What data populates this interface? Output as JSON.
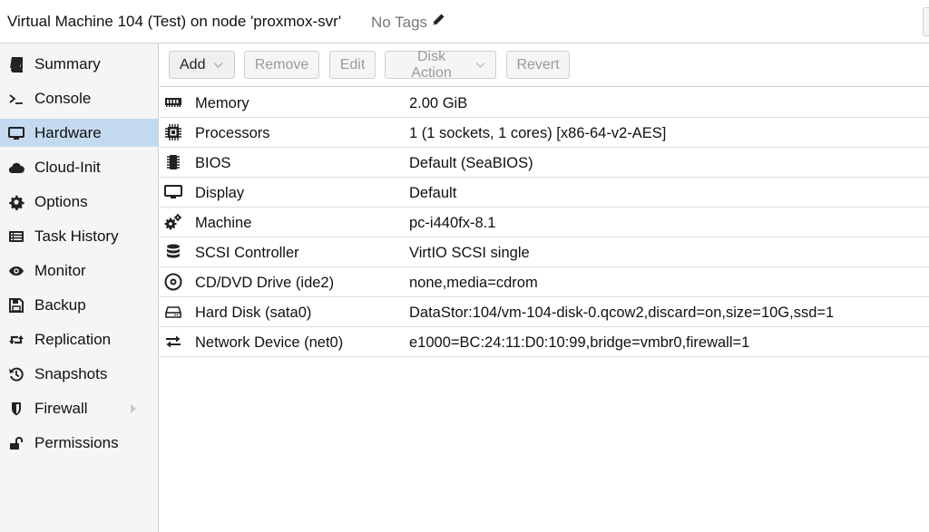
{
  "header": {
    "title": "Virtual Machine 104 (Test) on node 'proxmox-svr'",
    "tags_label": "No Tags"
  },
  "sidebar": {
    "items": [
      {
        "label": "Summary",
        "icon": "book-icon"
      },
      {
        "label": "Console",
        "icon": "terminal-icon"
      },
      {
        "label": "Hardware",
        "icon": "desktop-icon",
        "active": true
      },
      {
        "label": "Cloud-Init",
        "icon": "cloud-icon"
      },
      {
        "label": "Options",
        "icon": "gear-icon"
      },
      {
        "label": "Task History",
        "icon": "list-icon"
      },
      {
        "label": "Monitor",
        "icon": "eye-icon"
      },
      {
        "label": "Backup",
        "icon": "floppy-icon"
      },
      {
        "label": "Replication",
        "icon": "retweet-icon"
      },
      {
        "label": "Snapshots",
        "icon": "history-icon"
      },
      {
        "label": "Firewall",
        "icon": "shield-icon",
        "expandable": true
      },
      {
        "label": "Permissions",
        "icon": "unlock-icon"
      }
    ]
  },
  "toolbar": {
    "add_label": "Add",
    "remove_label": "Remove",
    "edit_label": "Edit",
    "disk_action_label": "Disk Action",
    "revert_label": "Revert"
  },
  "hardware": {
    "rows": [
      {
        "name": "Memory",
        "value": "2.00 GiB",
        "icon": "memory-icon"
      },
      {
        "name": "Processors",
        "value": "1 (1 sockets, 1 cores) [x86-64-v2-AES]",
        "icon": "cpu-icon"
      },
      {
        "name": "BIOS",
        "value": "Default (SeaBIOS)",
        "icon": "chip-icon"
      },
      {
        "name": "Display",
        "value": "Default",
        "icon": "desktop-icon"
      },
      {
        "name": "Machine",
        "value": "pc-i440fx-8.1",
        "icon": "cogs-icon"
      },
      {
        "name": "SCSI Controller",
        "value": "VirtIO SCSI single",
        "icon": "database-icon"
      },
      {
        "name": "CD/DVD Drive (ide2)",
        "value": "none,media=cdrom",
        "icon": "cdrom-icon"
      },
      {
        "name": "Hard Disk (sata0)",
        "value": "DataStor:104/vm-104-disk-0.qcow2,discard=on,size=10G,ssd=1",
        "icon": "hdd-icon"
      },
      {
        "name": "Network Device (net0)",
        "value": "e1000=BC:24:11:D0:10:99,bridge=vmbr0,firewall=1",
        "icon": "exchange-icon"
      }
    ]
  },
  "colors": {
    "active_nav": "#c4daf0",
    "sidebar_bg": "#f5f5f5",
    "border": "#d0d0d0"
  }
}
